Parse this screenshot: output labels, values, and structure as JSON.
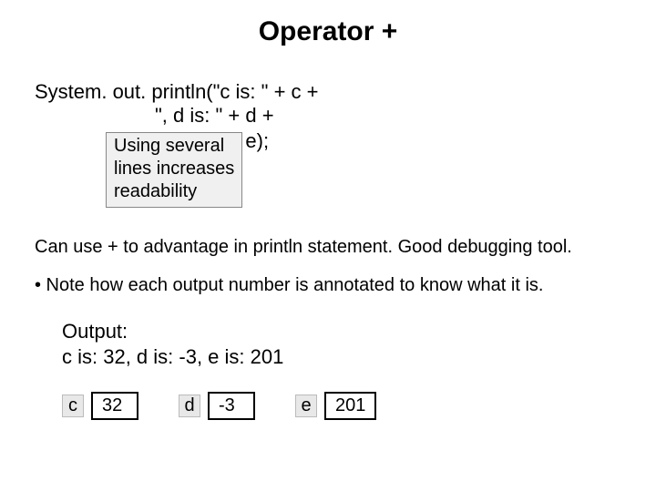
{
  "title": "Operator +",
  "code": {
    "line1": "System. out. println(\"c is: \" + c +",
    "line2": "\", d is: \" + d +",
    "line3": "\", e is: \" + e);"
  },
  "note": {
    "l1": "Using several",
    "l2": "lines increases",
    "l3": "readability"
  },
  "para1": "Can use + to advantage in println statement. Good debugging tool.",
  "para2": "• Note how each output number is annotated to know what it is.",
  "output": {
    "label": "Output:",
    "line": "c is: 32, d is: -3, e is: 201"
  },
  "vars": {
    "c": {
      "name": "c",
      "value": "32"
    },
    "d": {
      "name": "d",
      "value": "-3"
    },
    "e": {
      "name": "e",
      "value": "201"
    }
  }
}
